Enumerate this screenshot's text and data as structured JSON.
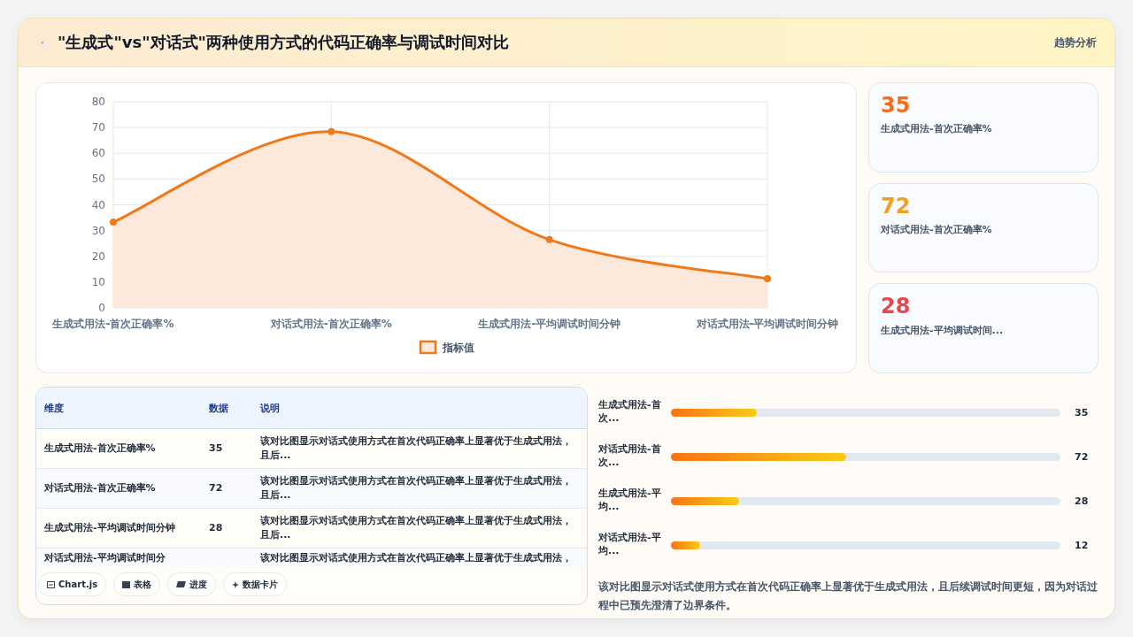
{
  "header": {
    "title": "\"生成式\"vs\"对话式\"两种使用方式的代码正确率与调试时间对比",
    "tag": "趋势分析"
  },
  "chart": {
    "chart_data": {
      "type": "area",
      "categories": [
        "生成式用法-首次正确率%",
        "对话式用法-首次正确率%",
        "生成式用法-平均调试时间分钟",
        "对话式用法-平均调试时间分钟"
      ],
      "series": [
        {
          "name": "指标值",
          "color": "#f07a1a",
          "values": [
            33.3,
            68.4,
            26.5,
            11.3
          ]
        }
      ],
      "ylim": [
        0,
        80
      ],
      "grid": true,
      "yticks": [
        0,
        10,
        20,
        30,
        40,
        50,
        60,
        70,
        80
      ]
    }
  },
  "stats": [
    {
      "value": "35",
      "label": "生成式用法-首次正确率%",
      "color": "#f46d1b"
    },
    {
      "value": "72",
      "label": "对话式用法-首次正确率%",
      "color": "#f0a01a"
    },
    {
      "value": "28",
      "label": "生成式用法-平均调试时间...",
      "color": "#e5484d"
    }
  ],
  "table": {
    "columns": [
      "维度",
      "数据",
      "说明"
    ],
    "rows": [
      [
        "生成式用法-首次正确率%",
        "35",
        "该对比图显示对话式使用方式在首次代码正确率上显著优于生成式用法，且后..."
      ],
      [
        "对话式用法-首次正确率%",
        "72",
        "该对比图显示对话式使用方式在首次代码正确率上显著优于生成式用法，且后..."
      ],
      [
        "生成式用法-平均调试时间分钟",
        "28",
        "该对比图显示对话式使用方式在首次代码正确率上显著优于生成式用法，且后..."
      ],
      [
        "对话式用法-平均调试时间分",
        "",
        "该对比图显示对话式使用方式在首次代码正确率上显著优于生成式用法，"
      ]
    ]
  },
  "toolbar": [
    {
      "kind": "chart",
      "label": "Chart.js"
    },
    {
      "kind": "table",
      "label": "表格"
    },
    {
      "kind": "progress",
      "label": "进度"
    },
    {
      "kind": "cards",
      "label": "数据卡片"
    }
  ],
  "bars": [
    {
      "label": "生成式用法-首次...",
      "value": "35",
      "level": 0.22
    },
    {
      "label": "对话式用法-首次...",
      "value": "72",
      "level": 0.45
    },
    {
      "label": "生成式用法-平均...",
      "value": "28",
      "level": 0.175
    },
    {
      "label": "对话式用法-平均...",
      "value": "12",
      "level": 0.075
    }
  ],
  "summary": "该对比图显示对话式使用方式在首次代码正确率上显著优于生成式用法，且后续调试时间更短，因为对话过程中已预先澄清了边界条件。"
}
